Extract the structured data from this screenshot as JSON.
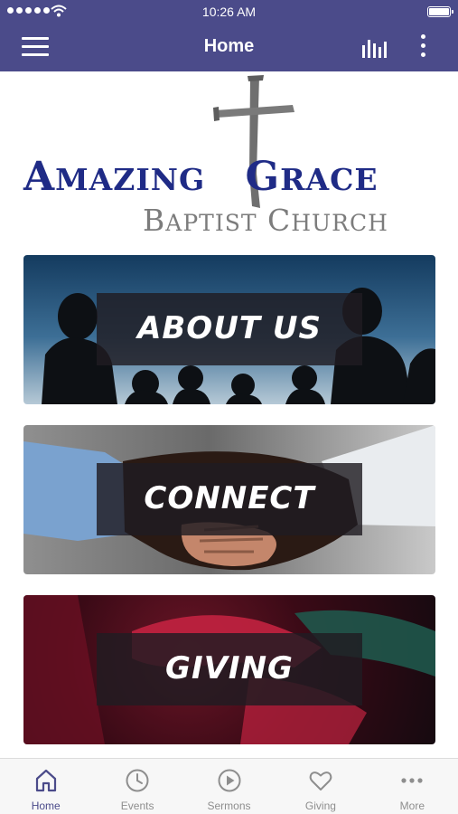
{
  "status_bar": {
    "time": "10:26 AM"
  },
  "header": {
    "title": "Home"
  },
  "logo": {
    "line1_first": "A",
    "line1_rest": "MAZING",
    "line1_gap": " ",
    "line1_g": "G",
    "line1_g_rest": "RACE",
    "line2_first": "B",
    "line2_rest": "APTIST",
    "line2_gap": " ",
    "line2_c": "C",
    "line2_c_rest": "HURCH"
  },
  "tiles": [
    {
      "label": "ABOUT US"
    },
    {
      "label": "CONNECT"
    },
    {
      "label": "GIVING"
    }
  ],
  "tab_bar": {
    "items": [
      {
        "label": "Home",
        "icon": "home-icon",
        "active": true
      },
      {
        "label": "Events",
        "icon": "clock-icon",
        "active": false
      },
      {
        "label": "Sermons",
        "icon": "play-icon",
        "active": false
      },
      {
        "label": "Giving",
        "icon": "heart-icon",
        "active": false
      },
      {
        "label": "More",
        "icon": "more-dots-icon",
        "active": false
      }
    ]
  },
  "colors": {
    "brand": "#4b4b8a",
    "logo_blue": "#1f2b86",
    "logo_gray": "#7c7c7c",
    "tab_inactive": "#8e8e8e"
  }
}
